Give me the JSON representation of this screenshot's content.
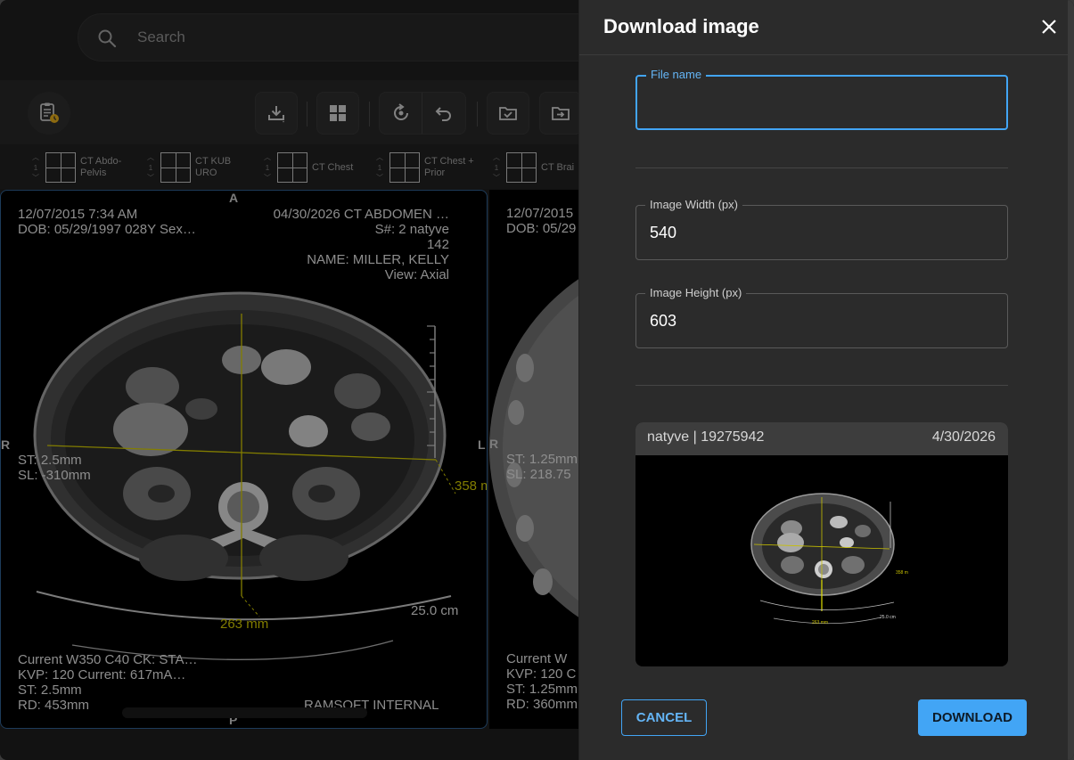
{
  "search": {
    "placeholder": "Search"
  },
  "layouts": [
    {
      "count": "1",
      "label": "CT Abdo-Pelvis"
    },
    {
      "count": "1",
      "label": "CT KUB URO"
    },
    {
      "count": "1",
      "label": "CT Chest"
    },
    {
      "count": "1",
      "label": "CT Chest + Prior"
    },
    {
      "count": "1",
      "label": "CT Brai"
    }
  ],
  "viewport1": {
    "top_left": [
      "12/07/2015 7:34 AM",
      "DOB: 05/29/1997  028Y  Sex…"
    ],
    "top_right": [
      "04/30/2026  CT ABDOMEN …",
      "S#: 2  natyve",
      "142",
      "NAME: MILLER, KELLY",
      "View: Axial"
    ],
    "mid_left": [
      "ST: 2.5mm",
      "SL: -310mm"
    ],
    "bottom_left": [
      "Current  W350 C40  CK: STA…",
      "KVP: 120  Current: 617mA…",
      "ST: 2.5mm",
      "RD: 453mm"
    ],
    "bottom_right": "RAMSOFT INTERNAL",
    "marker_top": "A",
    "marker_left": "R",
    "marker_right": "L",
    "marker_bottom": "P",
    "measure_h": "263 mm",
    "measure_v": "358 m",
    "scale": "25.0 cm"
  },
  "viewport2": {
    "top_left": [
      "12/07/2015",
      "DOB: 05/29"
    ],
    "mid_left": [
      "ST: 1.25mm",
      "SL: 218.75"
    ],
    "bottom_left": [
      "Current  W",
      "KVP: 120  C",
      "ST: 1.25mm",
      "RD: 360mm"
    ],
    "marker_left": "R"
  },
  "dialog": {
    "title": "Download image",
    "file_name_label": "File name",
    "file_name_value": "",
    "width_label": "Image Width (px)",
    "width_value": "540",
    "height_label": "Image Height (px)",
    "height_value": "603",
    "preview_left": "natyve | 19275942",
    "preview_right": "4/30/2026",
    "cancel_label": "CANCEL",
    "download_label": "DOWNLOAD"
  },
  "colors": {
    "accent": "#42a5f5",
    "drawer_bg": "#2b2b2b",
    "crosshair": "#c8c000"
  }
}
